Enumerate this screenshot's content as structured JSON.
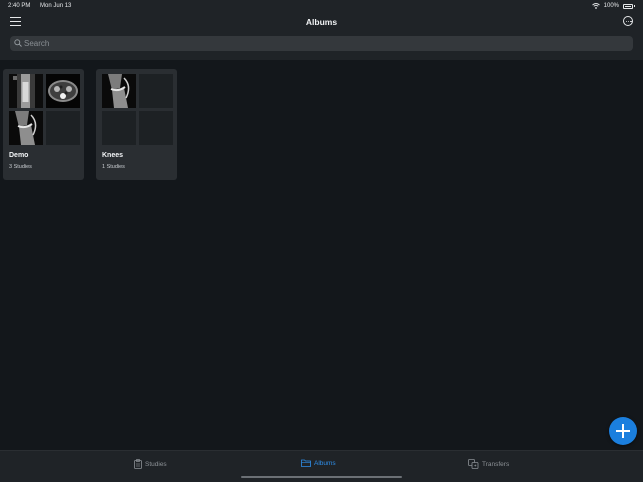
{
  "status": {
    "time": "2:40 PM",
    "date": "Mon Jun 13",
    "battery": "100%"
  },
  "nav": {
    "title": "Albums"
  },
  "search": {
    "placeholder": "Search",
    "value": ""
  },
  "albums": [
    {
      "name": "Demo",
      "count": "3 Studies"
    },
    {
      "name": "Knees",
      "count": "1 Studies"
    }
  ],
  "tabs": [
    {
      "label": "Studies",
      "icon": "clipboard-icon",
      "active": false
    },
    {
      "label": "Albums",
      "icon": "folder-icon",
      "active": true
    },
    {
      "label": "Transfers",
      "icon": "transfer-icon",
      "active": false
    }
  ],
  "colors": {
    "background": "#13171b",
    "bar": "#1f2327",
    "card": "#2a2e32",
    "accent": "#2f8fea",
    "fab": "#1b7fde"
  }
}
